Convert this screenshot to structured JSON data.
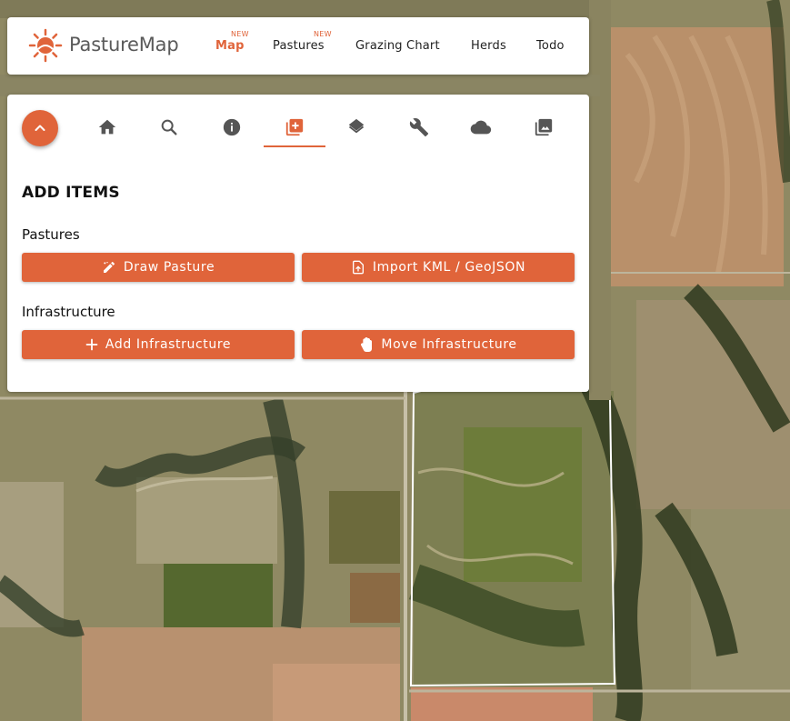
{
  "app": {
    "brand": "PastureMap"
  },
  "nav": {
    "items": [
      {
        "label": "Map",
        "badge": "NEW",
        "active": true
      },
      {
        "label": "Pastures",
        "badge": "NEW",
        "active": false
      },
      {
        "label": "Grazing Chart",
        "badge": "",
        "active": false
      },
      {
        "label": "Herds",
        "badge": "",
        "active": false
      },
      {
        "label": "Todo",
        "badge": "",
        "active": false
      }
    ]
  },
  "toolbar": {
    "icons": [
      "collapse-chevron-up-icon",
      "home-icon",
      "search-icon",
      "info-icon",
      "add-items-icon",
      "layers-icon",
      "wrench-icon",
      "cloud-icon",
      "photos-icon"
    ],
    "active": "add-items-icon"
  },
  "panel": {
    "title": "ADD ITEMS",
    "pastures_label": "Pastures",
    "infrastructure_label": "Infrastructure",
    "buttons": {
      "draw_pasture": "Draw Pasture",
      "import_kml": "Import KML / GeoJSON",
      "add_infrastructure": "Add Infrastructure",
      "move_infrastructure": "Move Infrastructure"
    }
  },
  "colors": {
    "accent": "#e0643a",
    "text": "#111111",
    "brand_text": "#5a5a5a"
  }
}
